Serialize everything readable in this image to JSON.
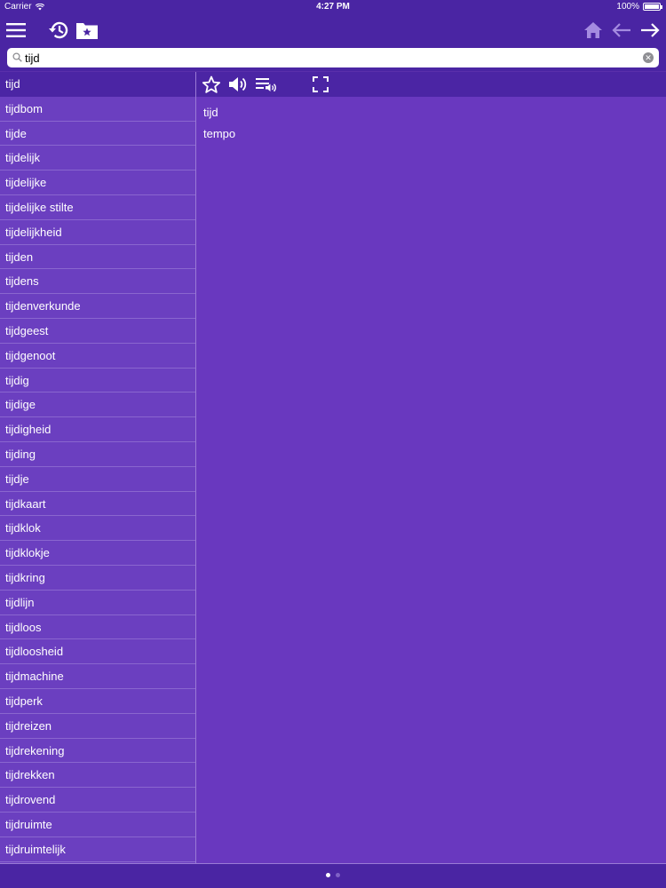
{
  "status": {
    "carrier": "Carrier",
    "time": "4:27 PM",
    "battery": "100%"
  },
  "icons": {
    "menu": "hamburger-menu-icon",
    "history": "history-clock-icon",
    "favorites_folder": "star-folder-icon",
    "home": "home-icon",
    "back": "arrow-left-icon",
    "forward": "arrow-right-icon",
    "star": "star-outline-icon",
    "speaker": "speaker-icon",
    "playlist": "playlist-audio-icon",
    "fullscreen": "fullscreen-icon"
  },
  "search": {
    "value": "tijd",
    "placeholder": ""
  },
  "words": [
    "tijd",
    "tijdbom",
    "tijde",
    "tijdelijk",
    "tijdelijke",
    "tijdelijke stilte",
    "tijdelijkheid",
    "tijden",
    "tijdens",
    "tijdenverkunde",
    "tijdgeest",
    "tijdgenoot",
    "tijdig",
    "tijdige",
    "tijdigheid",
    "tijding",
    "tijdje",
    "tijdkaart",
    "tijdklok",
    "tijdklokje",
    "tijdkring",
    "tijdlijn",
    "tijdloos",
    "tijdloosheid",
    "tijdmachine",
    "tijdperk",
    "tijdreizen",
    "tijdrekening",
    "tijdrekken",
    "tijdrovend",
    "tijdruimte",
    "tijdruimtelijk"
  ],
  "selected_index": 0,
  "detail": {
    "headword": "tijd",
    "translation": "tempo"
  },
  "colors": {
    "bar": "#4a25a3",
    "list_bg": "#6b3fc0",
    "detail_bg": "#6938bf",
    "accent_light": "#a48be0"
  }
}
